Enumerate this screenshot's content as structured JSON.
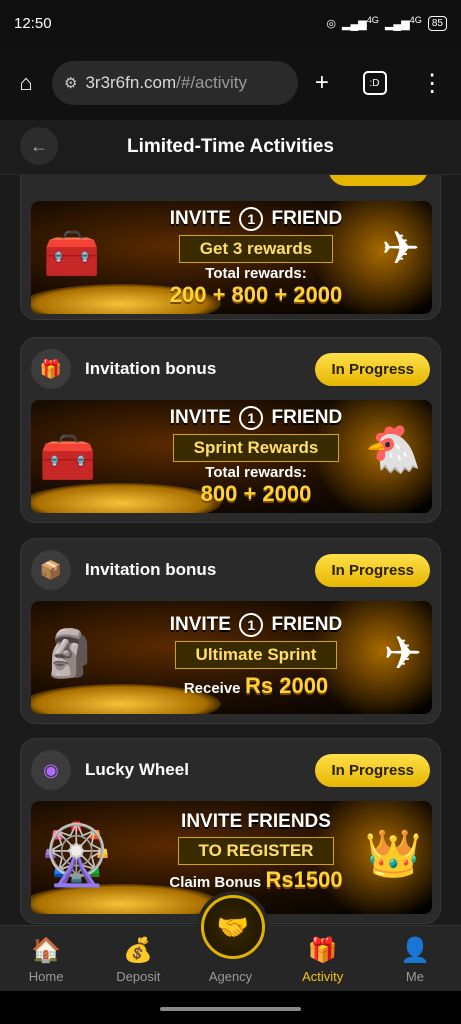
{
  "statusbar": {
    "time": "12:50",
    "signal1": "4G",
    "signal2": "4G",
    "battery": "85"
  },
  "browser": {
    "url_host": "3r3r6fn.com",
    "url_path": "/#/activity",
    "home_icon": "home-icon",
    "tab_label": ":D"
  },
  "header": {
    "title": "Limited-Time Activities"
  },
  "cards": [
    {
      "banner": {
        "line1a": "INVITE",
        "line1b": "1",
        "line1c": "FRIEND",
        "pill": "Get 3 rewards",
        "line3": "Total rewards:",
        "line4": "200 + 800 + 2000"
      }
    },
    {
      "title": "Invitation bonus",
      "status": "In Progress",
      "banner": {
        "line1a": "INVITE",
        "line1b": "1",
        "line1c": "FRIEND",
        "pill": "Sprint Rewards",
        "line3": "Total rewards:",
        "line4": "800 + 2000"
      }
    },
    {
      "title": "Invitation bonus",
      "status": "In Progress",
      "banner": {
        "line1a": "INVITE",
        "line1b": "1",
        "line1c": "FRIEND",
        "pill": "Ultimate Sprint",
        "line3": "Receive",
        "line4": "Rs 2000"
      }
    },
    {
      "title": "Lucky Wheel",
      "status": "In Progress",
      "banner": {
        "line1a": "INVITE FRIENDS",
        "pill": "TO REGISTER",
        "line3": "Claim Bonus",
        "line4": "Rs1500"
      }
    }
  ],
  "nav": {
    "items": [
      "Home",
      "Deposit",
      "Agency",
      "Activity",
      "Me"
    ],
    "active": "Activity"
  }
}
